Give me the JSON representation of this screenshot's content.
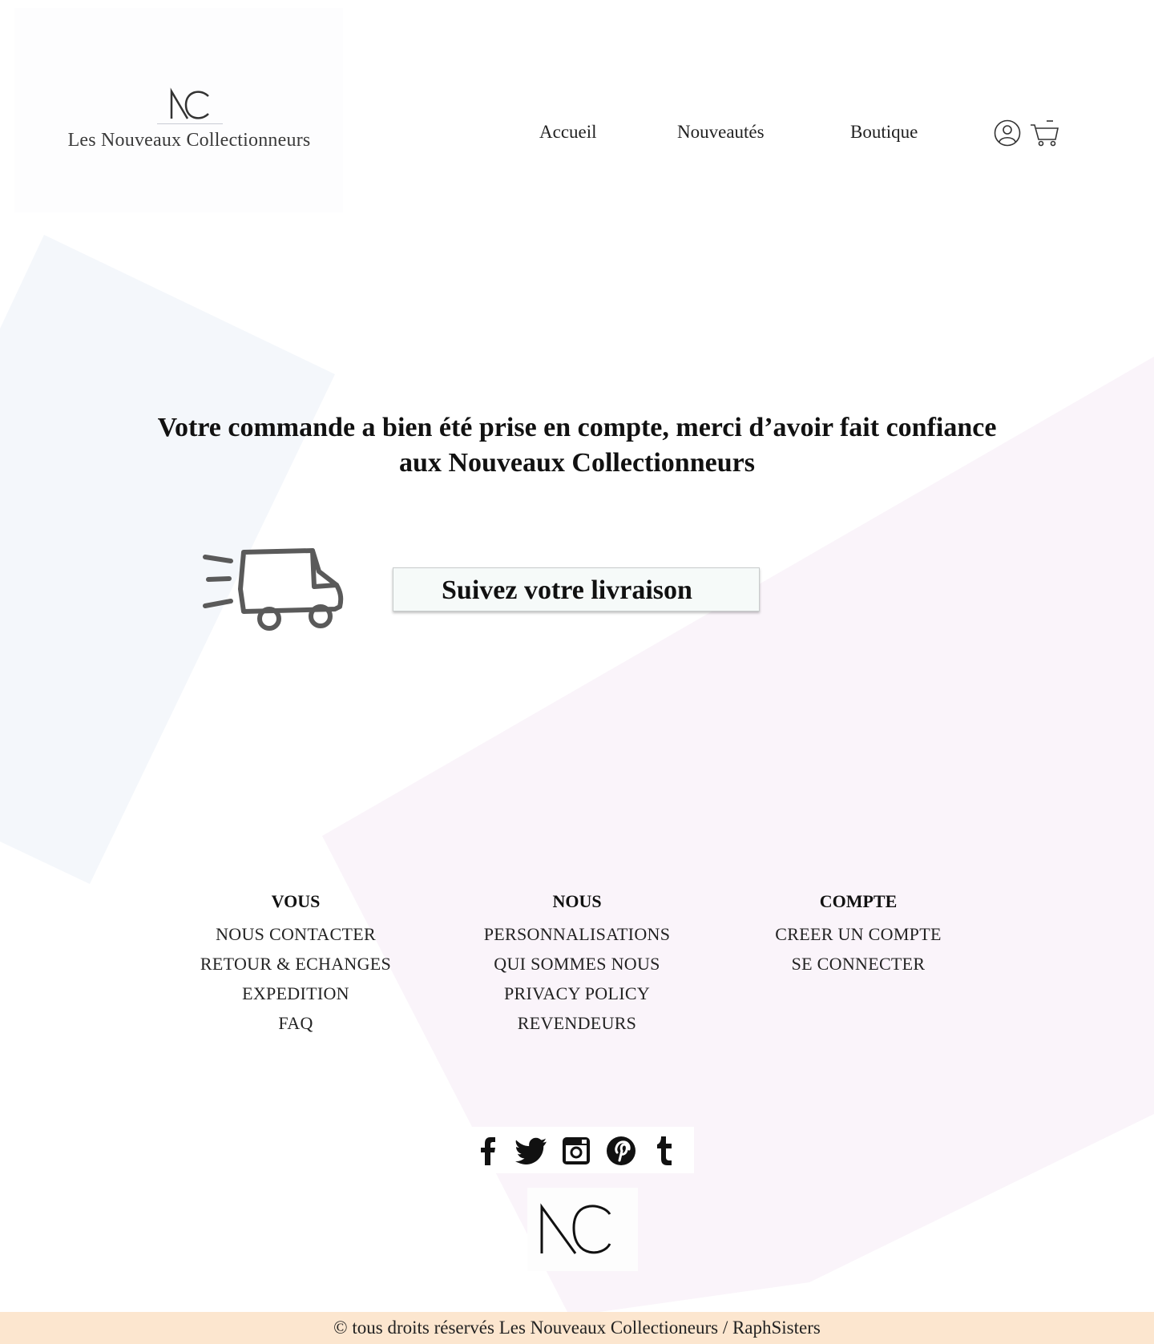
{
  "brand": {
    "name": "Les Nouveaux Collectionneurs",
    "logo_text": "NC"
  },
  "nav": {
    "items": [
      {
        "label": "Accueil"
      },
      {
        "label": "Nouveautés"
      },
      {
        "label": "Boutique"
      }
    ],
    "icons": [
      "user-icon",
      "cart-icon"
    ]
  },
  "main": {
    "headline_line1": "Votre commande a bien été prise en compte, merci d’avoir fait confiance",
    "headline_line2": "aux Nouveaux Collectionneurs",
    "track_button": "Suivez votre livraison",
    "truck_icon": "delivery-truck-icon"
  },
  "footer": {
    "columns": [
      {
        "title": "VOUS",
        "links": [
          "NOUS CONTACTER",
          "RETOUR & ECHANGES",
          "EXPEDITION",
          "FAQ"
        ]
      },
      {
        "title": "NOUS",
        "links": [
          "PERSONNALISATIONS",
          "QUI SOMMES NOUS",
          "PRIVACY POLICY",
          "REVENDEURS"
        ]
      },
      {
        "title": "COMPTE",
        "links": [
          "CREER UN COMPTE",
          "SE CONNECTER"
        ]
      }
    ],
    "social": [
      "facebook-icon",
      "twitter-icon",
      "instagram-icon",
      "pinterest-icon",
      "tumblr-icon"
    ],
    "copyright": "© tous droits réservés Les Nouveaux Collectioneurs / RaphSisters"
  },
  "colors": {
    "shape_blue": "#f4f7fb",
    "shape_pink": "#faf4fa",
    "copyright_bar": "#fce6cf",
    "button_bg": "#f6faf9"
  }
}
